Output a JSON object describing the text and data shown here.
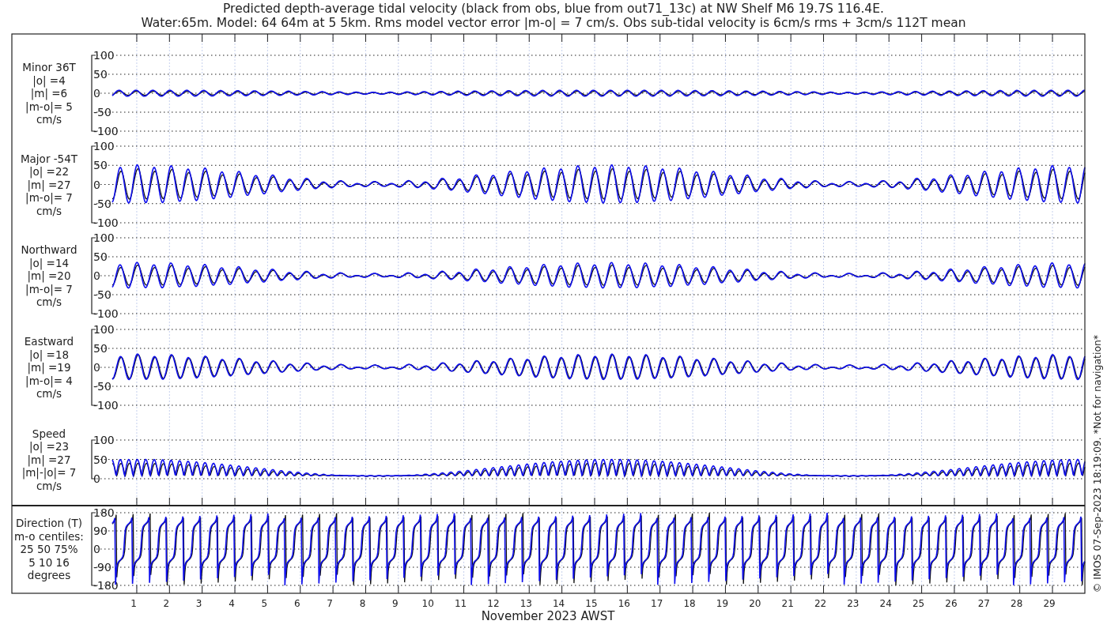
{
  "title": [
    "Predicted depth-average tidal velocity (black from obs, blue from out71_13c) at NW Shelf M6 19.7S 116.4E.",
    "Water:65m. Model: 64 64m at 5 5km. Rms model vector error |m-o| = 7 cm/s. Obs sub-tidal velocity is 6cm/s rms + 3cm/s 112T mean"
  ],
  "panels": [
    {
      "kind": "velocity",
      "label": [
        "Minor 36T",
        "|o| =4",
        "|m| =6",
        "|m-o|= 5",
        "cm/s"
      ],
      "yticks": [
        "100",
        "50",
        "0",
        "-50",
        "-100"
      ]
    },
    {
      "kind": "velocity",
      "label": [
        "Major -54T",
        "|o| =22",
        "|m| =27",
        "|m-o|= 7",
        "cm/s"
      ],
      "yticks": [
        "100",
        "50",
        "0",
        "-50",
        "-100"
      ]
    },
    {
      "kind": "velocity",
      "label": [
        "Northward",
        "|o| =14",
        "|m| =20",
        "|m-o|= 7",
        "cm/s"
      ],
      "yticks": [
        "100",
        "50",
        "0",
        "-50",
        "-100"
      ]
    },
    {
      "kind": "velocity",
      "label": [
        "Eastward",
        "|o| =18",
        "|m| =19",
        "|m-o|= 4",
        "cm/s"
      ],
      "yticks": [
        "100",
        "50",
        "0",
        "-50",
        "-100"
      ]
    },
    {
      "kind": "speed",
      "label": [
        "Speed",
        "|o| =23",
        "|m| =27",
        "|m|-|o|= 7",
        "cm/s"
      ],
      "yticks": [
        "100",
        "50",
        "0"
      ]
    },
    {
      "kind": "direction",
      "label": [
        "Direction (T)",
        "m-o centiles:",
        "25  50  75%",
        "5  10  16",
        "degrees"
      ],
      "yticks": [
        "180",
        "90",
        "0",
        "-90",
        "-180"
      ]
    }
  ],
  "xticks": [
    "1",
    "2",
    "3",
    "4",
    "5",
    "6",
    "7",
    "8",
    "9",
    "10",
    "11",
    "12",
    "13",
    "14",
    "15",
    "16",
    "17",
    "18",
    "19",
    "20",
    "21",
    "22",
    "23",
    "24",
    "25",
    "26",
    "27",
    "28",
    "29"
  ],
  "xlabel": "November 2023 AWST",
  "credit": "© IMOS 07-Sep-2023 18:19:09. *Not for navigation*"
}
